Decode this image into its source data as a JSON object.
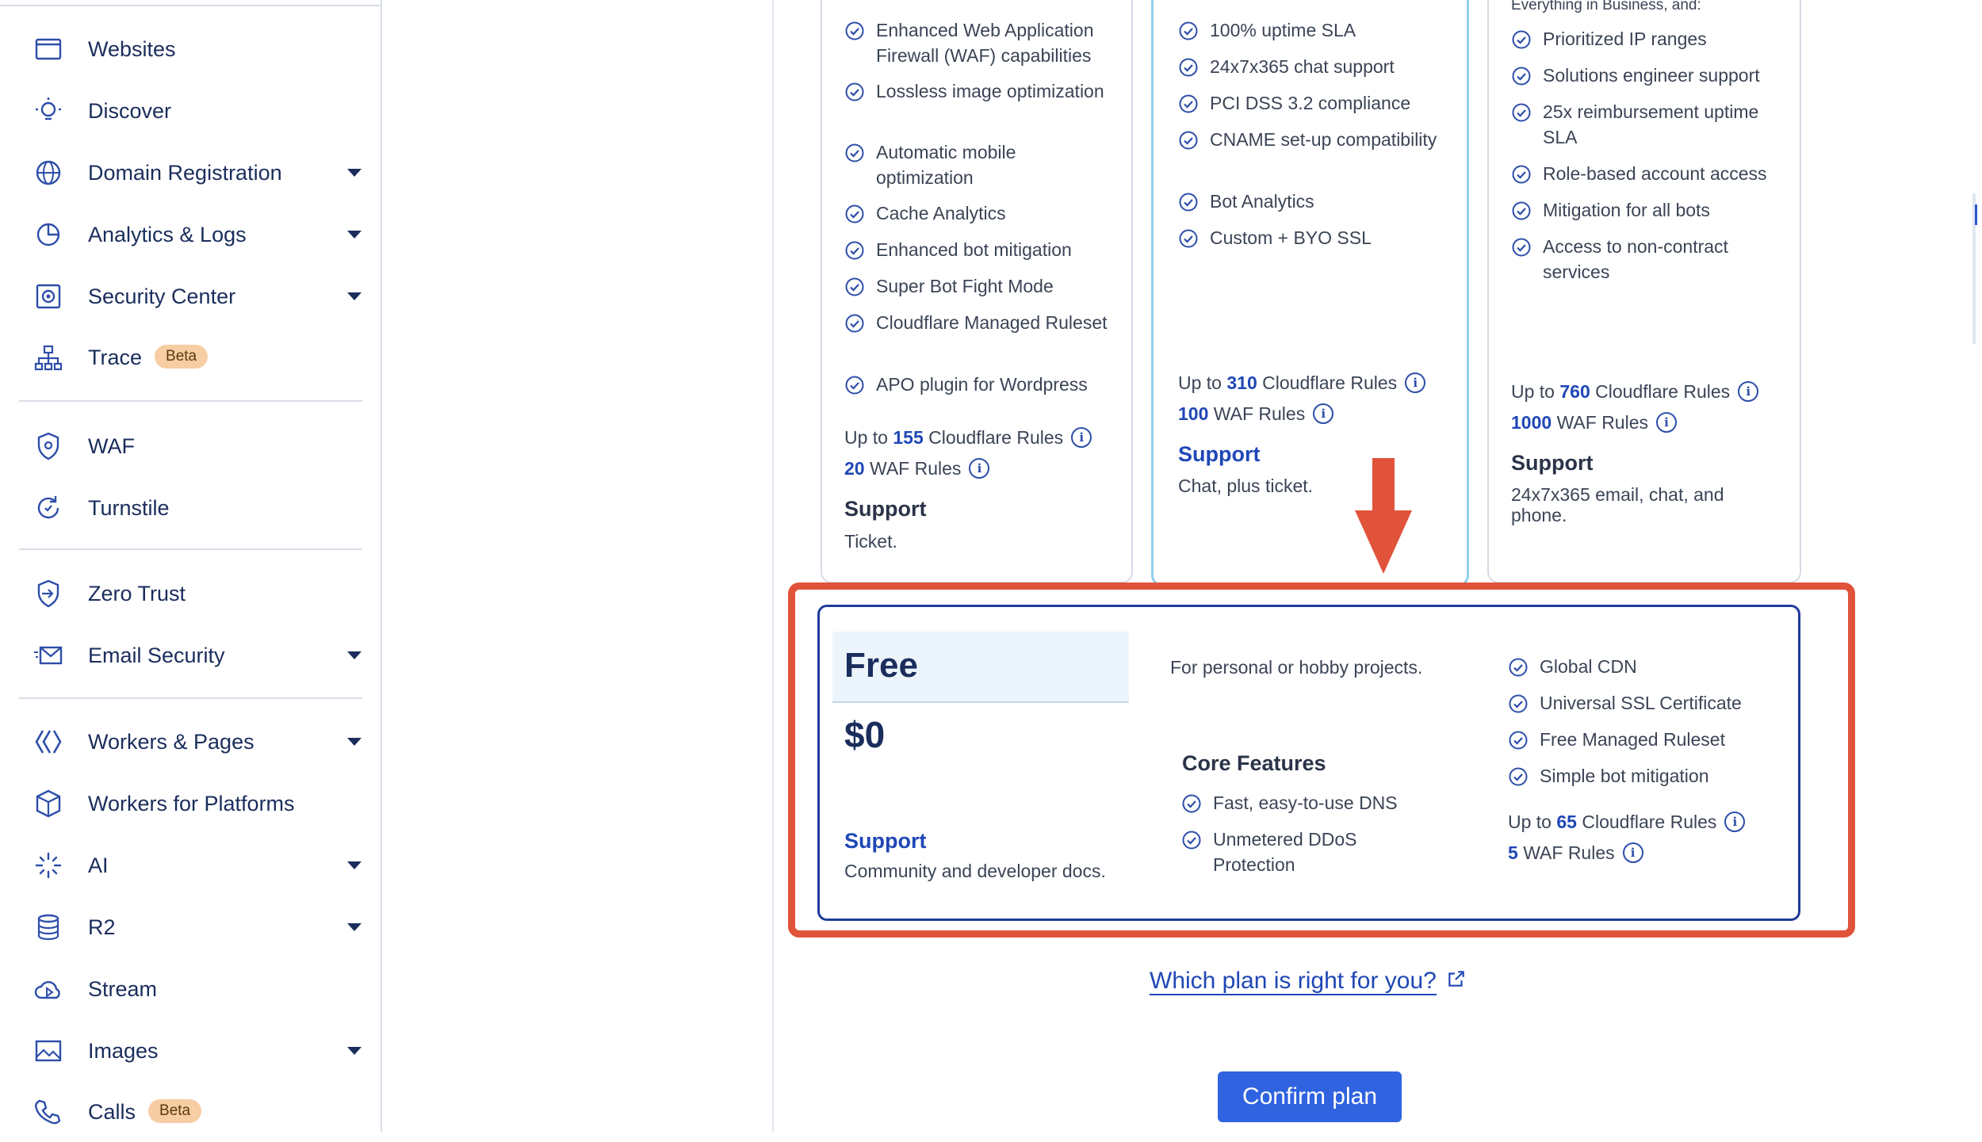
{
  "sidebar": {
    "items": [
      {
        "label": "Websites",
        "icon": "browser-window-icon",
        "caret": false,
        "badge": ""
      },
      {
        "label": "Discover",
        "icon": "lightbulb-icon",
        "caret": false,
        "badge": ""
      },
      {
        "label": "Domain Registration",
        "icon": "globe-icon",
        "caret": true,
        "badge": ""
      },
      {
        "label": "Analytics & Logs",
        "icon": "pie-chart-icon",
        "caret": true,
        "badge": ""
      },
      {
        "label": "Security Center",
        "icon": "security-gear-icon",
        "caret": true,
        "badge": ""
      },
      {
        "label": "Trace",
        "icon": "trace-network-icon",
        "caret": false,
        "badge": "Beta"
      },
      {
        "label": "WAF",
        "icon": "shield-gear-icon",
        "caret": false,
        "badge": ""
      },
      {
        "label": "Turnstile",
        "icon": "turnstile-refresh-icon",
        "caret": false,
        "badge": ""
      },
      {
        "label": "Zero Trust",
        "icon": "zero-trust-shield-icon",
        "caret": false,
        "badge": ""
      },
      {
        "label": "Email Security",
        "icon": "envelope-icon",
        "caret": true,
        "badge": ""
      },
      {
        "label": "Workers & Pages",
        "icon": "workers-icon",
        "caret": true,
        "badge": ""
      },
      {
        "label": "Workers for Platforms",
        "icon": "cube-icon",
        "caret": false,
        "badge": ""
      },
      {
        "label": "AI",
        "icon": "sparkle-icon",
        "caret": true,
        "badge": ""
      },
      {
        "label": "R2",
        "icon": "database-icon",
        "caret": true,
        "badge": ""
      },
      {
        "label": "Stream",
        "icon": "cloud-play-icon",
        "caret": false,
        "badge": ""
      },
      {
        "label": "Images",
        "icon": "image-icon",
        "caret": true,
        "badge": ""
      },
      {
        "label": "Calls",
        "icon": "phone-icon",
        "caret": false,
        "badge": "Beta"
      }
    ]
  },
  "plans": {
    "pro": {
      "features": [
        "Enhanced Web Application Firewall (WAF) capabilities",
        "Lossless image optimization",
        "Automatic mobile optimization",
        "Cache Analytics",
        "Enhanced bot mitigation",
        "Super Bot Fight Mode",
        "Cloudflare Managed Ruleset",
        "APO plugin for Wordpress"
      ],
      "rules_prefix": "Up to",
      "rules_count": "155",
      "rules_label": "Cloudflare Rules",
      "waf_count": "20",
      "waf_label": "WAF Rules",
      "support_title": "Support",
      "support_text": "Ticket."
    },
    "business": {
      "features": [
        "100% uptime SLA",
        "24x7x365 chat support",
        "PCI DSS 3.2 compliance",
        "CNAME set-up compatibility",
        "Bot Analytics",
        "Custom + BYO SSL"
      ],
      "rules_prefix": "Up to",
      "rules_count": "310",
      "rules_label": "Cloudflare Rules",
      "waf_count": "100",
      "waf_label": "WAF Rules",
      "support_title": "Support",
      "support_text": "Chat, plus ticket."
    },
    "enterprise": {
      "heading_cut": "Everything in Business, and:",
      "features": [
        "Prioritized IP ranges",
        "Solutions engineer support",
        "25x reimbursement uptime SLA",
        "Role-based account access",
        "Mitigation for all bots",
        "Access to non-contract services"
      ],
      "rules_prefix": "Up to",
      "rules_count": "760",
      "rules_label": "Cloudflare Rules",
      "waf_count": "1000",
      "waf_label": "WAF Rules",
      "support_title": "Support",
      "support_text": "24x7x365 email, chat, and phone."
    },
    "free": {
      "name": "Free",
      "price": "$0",
      "description": "For personal or hobby projects.",
      "support_title": "Support",
      "support_text": "Community and developer docs.",
      "core_title": "Core Features",
      "core_features": [
        "Fast, easy-to-use DNS",
        "Unmetered DDoS Protection"
      ],
      "features": [
        "Global CDN",
        "Universal SSL Certificate",
        "Free Managed Ruleset",
        "Simple bot mitigation"
      ],
      "rules_prefix": "Up to",
      "rules_count": "65",
      "rules_label": "Cloudflare Rules",
      "waf_count": "5",
      "waf_label": "WAF Rules"
    }
  },
  "info_glyph": "i",
  "help_link": "Which plan is right for you?",
  "confirm_button": "Confirm plan",
  "colors": {
    "accent": "#1f47b6",
    "button": "#2f63e0",
    "highlight": "#e0533a",
    "selected_border": "#8fd0ea"
  }
}
